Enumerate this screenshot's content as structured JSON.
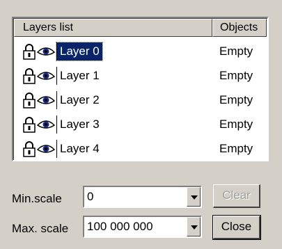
{
  "list": {
    "header_layers": "Layers list",
    "header_objects": "Objects",
    "rows": [
      {
        "name": "Layer 0",
        "objects": "Empty",
        "selected": true
      },
      {
        "name": "Layer 1",
        "objects": "Empty"
      },
      {
        "name": "Layer 2",
        "objects": "Empty"
      },
      {
        "name": "Layer 3",
        "objects": "Empty"
      },
      {
        "name": "Layer 4",
        "objects": "Empty"
      }
    ]
  },
  "min_scale": {
    "label": "Min.scale",
    "value": "0"
  },
  "max_scale": {
    "label": "Max. scale",
    "value": "100 000 000"
  },
  "buttons": {
    "clear": "Clear",
    "close": "Close"
  },
  "icons": {
    "lock": "padlock-icon",
    "visibility": "eye-icon"
  },
  "colors": {
    "selection": "#0a246a",
    "face": "#d4d0c8"
  }
}
